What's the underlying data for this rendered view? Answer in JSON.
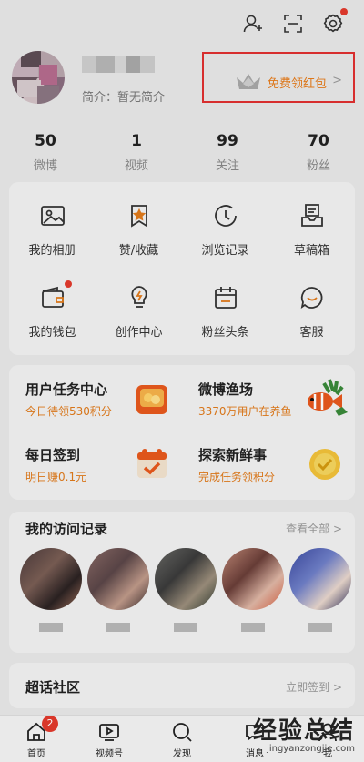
{
  "profile": {
    "bio": "简介：暂无简介",
    "redpacket_label": "免费领红包",
    "chevron": ">"
  },
  "stats": [
    {
      "num": "50",
      "label": "微博"
    },
    {
      "num": "1",
      "label": "视频"
    },
    {
      "num": "99",
      "label": "关注"
    },
    {
      "num": "70",
      "label": "粉丝"
    }
  ],
  "grid": [
    {
      "label": "我的相册",
      "icon": "image-icon"
    },
    {
      "label": "赞/收藏",
      "icon": "star-bookmark-icon"
    },
    {
      "label": "浏览记录",
      "icon": "clock-icon"
    },
    {
      "label": "草稿箱",
      "icon": "inbox-icon"
    },
    {
      "label": "我的钱包",
      "icon": "wallet-icon"
    },
    {
      "label": "创作中心",
      "icon": "lightbulb-icon"
    },
    {
      "label": "粉丝头条",
      "icon": "calendar-icon"
    },
    {
      "label": "客服",
      "icon": "smile-chat-icon"
    }
  ],
  "tasks": [
    {
      "title": "用户任务中心",
      "sub": "今日待领530积分"
    },
    {
      "title": "微博渔场",
      "sub": "3370万用户在养鱼"
    },
    {
      "title": "每日签到",
      "sub": "明日赚0.1元"
    },
    {
      "title": "探索新鲜事",
      "sub": "完成任务领积分"
    }
  ],
  "visits": {
    "title": "我的访问记录",
    "more": "查看全部  >"
  },
  "chaohua": {
    "title": "超话社区",
    "more": "立即签到  >"
  },
  "tabbar": [
    {
      "label": "首页",
      "badge": "2"
    },
    {
      "label": "视频号"
    },
    {
      "label": "发现"
    },
    {
      "label": "消息"
    },
    {
      "label": "我"
    }
  ],
  "watermark": {
    "line1": "经验总结",
    "line2": "jingyanzongjie.com"
  },
  "colors": {
    "accent": "#e07a1b",
    "red": "#e23a2c",
    "highlight_box": "#e03030"
  }
}
